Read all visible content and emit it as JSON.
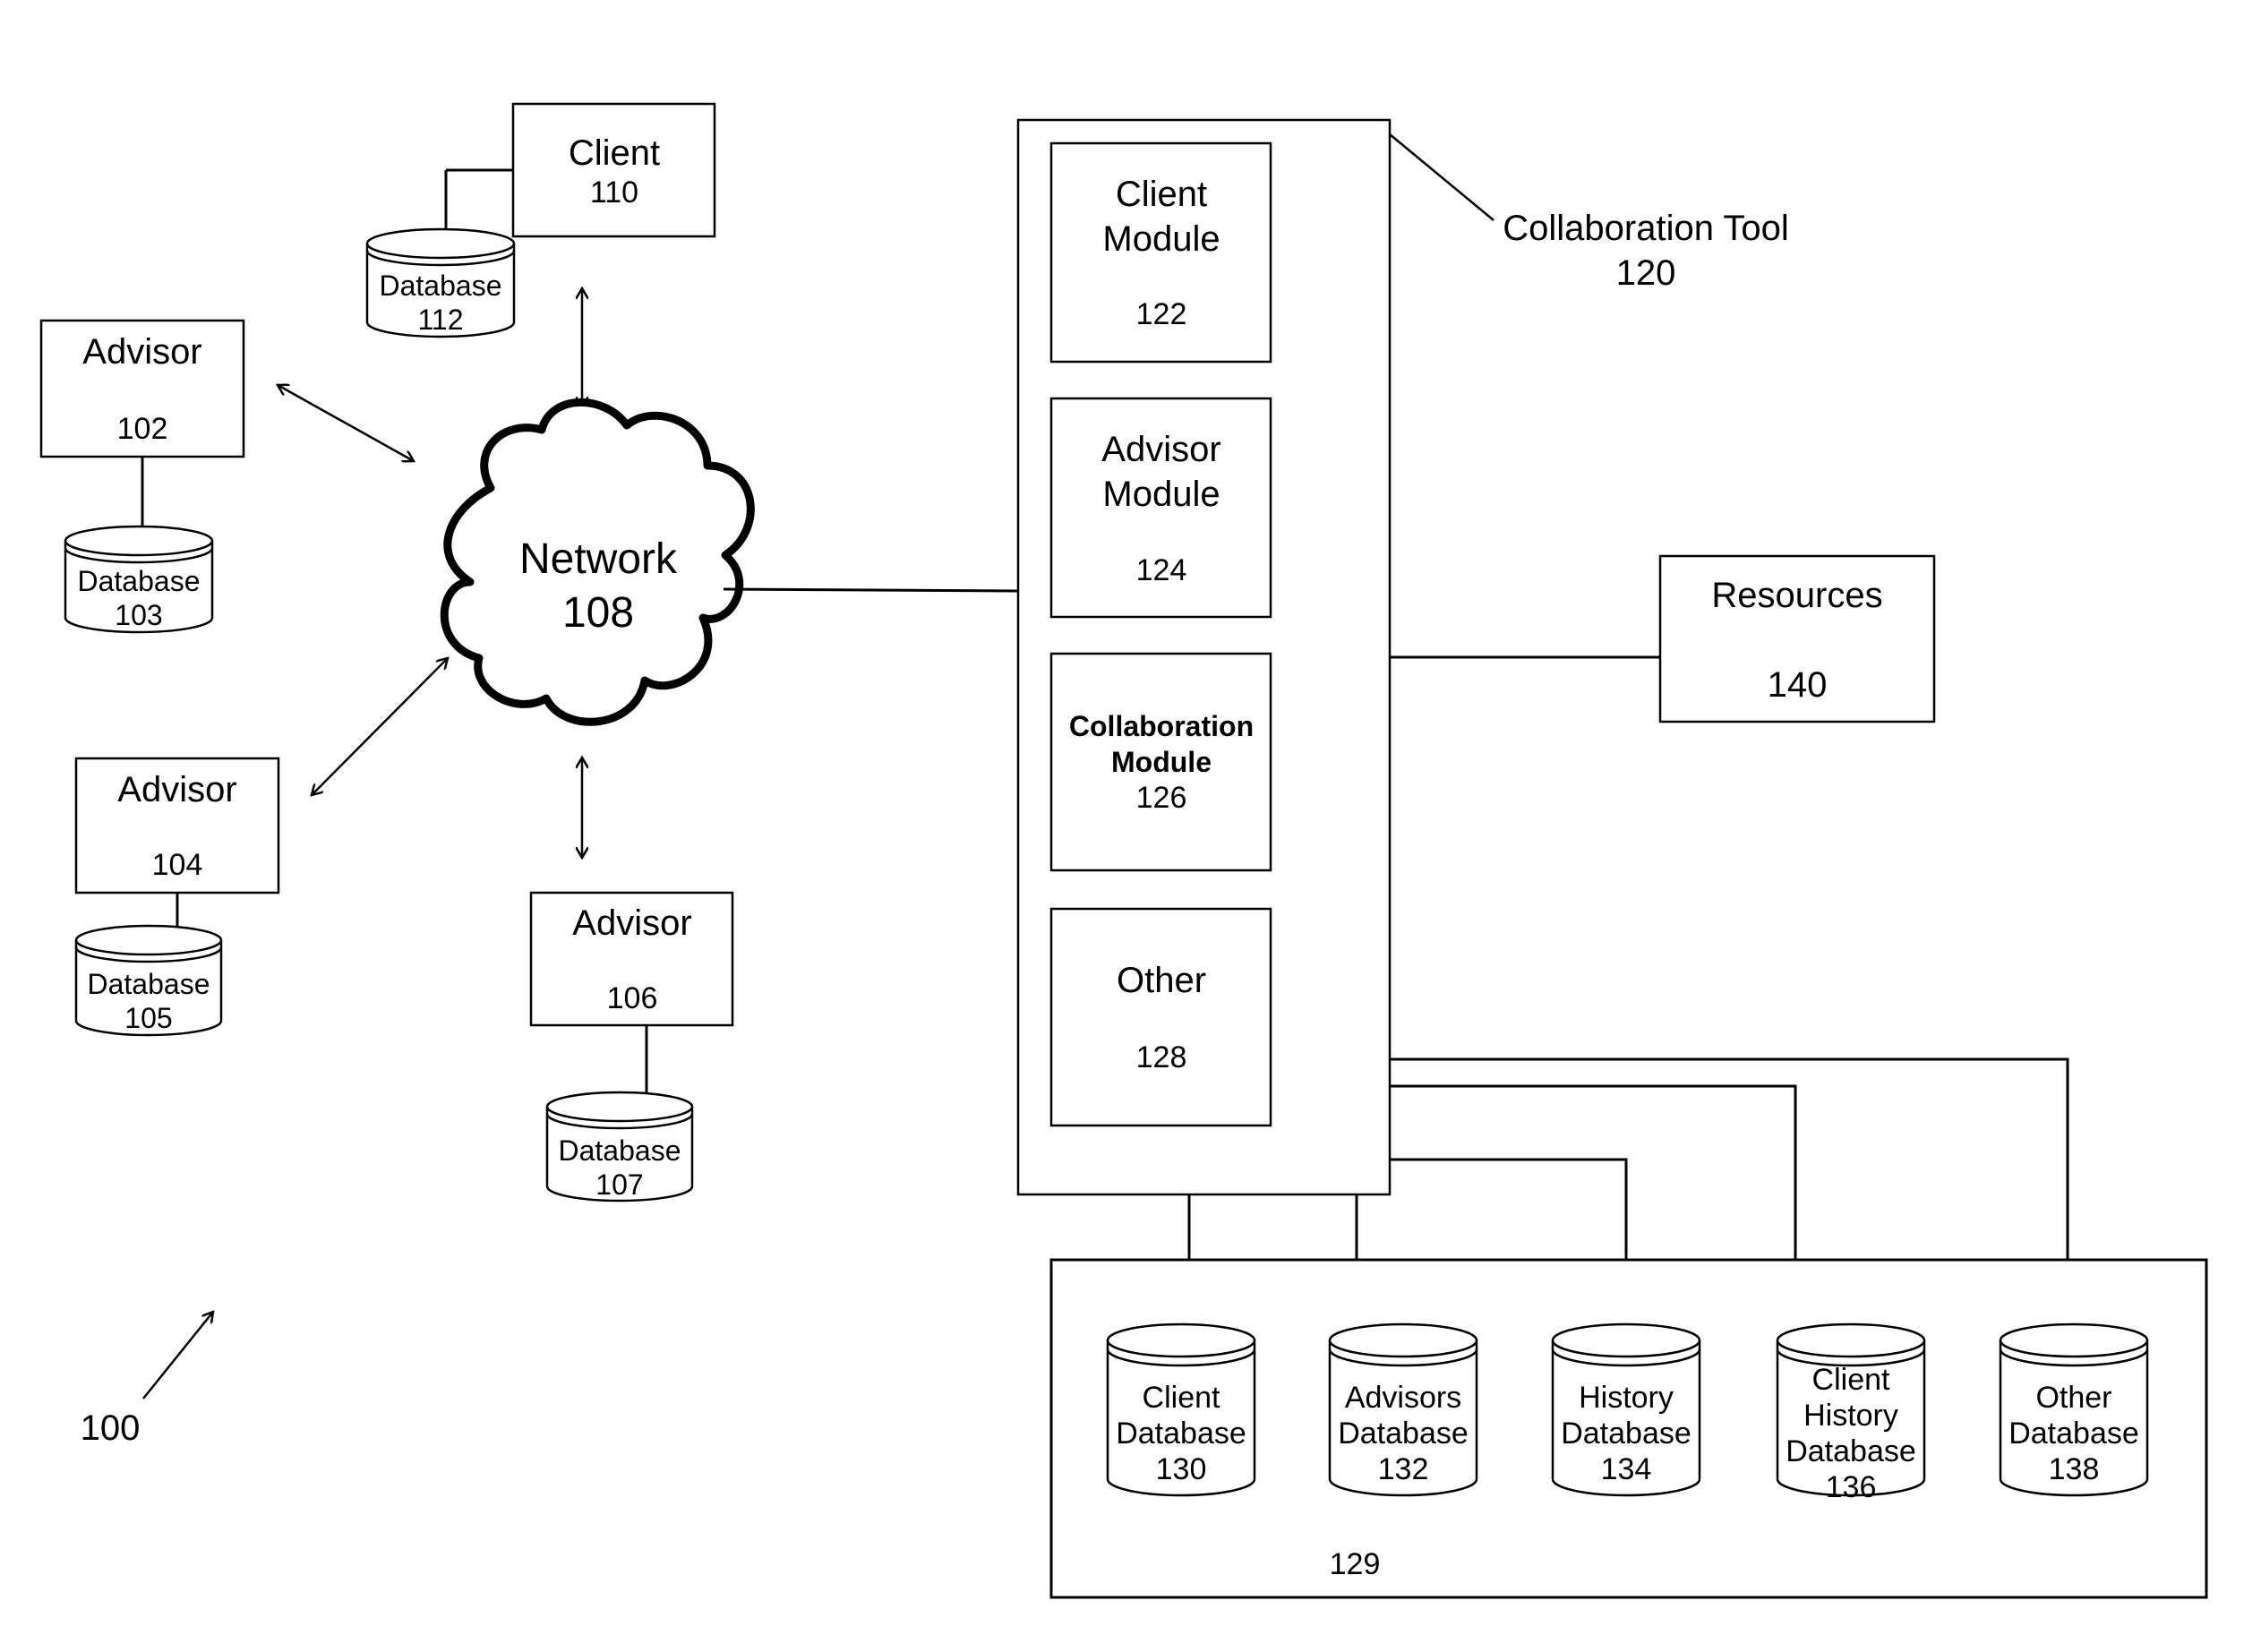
{
  "figure_label": "100",
  "network": {
    "name": "Network",
    "id": "108"
  },
  "client": {
    "name": "Client",
    "id": "110",
    "database": {
      "name": "Database",
      "id": "112"
    }
  },
  "advisors": [
    {
      "name": "Advisor",
      "id": "102",
      "database": {
        "name": "Database",
        "id": "103"
      }
    },
    {
      "name": "Advisor",
      "id": "104",
      "database": {
        "name": "Database",
        "id": "105"
      }
    },
    {
      "name": "Advisor",
      "id": "106",
      "database": {
        "name": "Database",
        "id": "107"
      }
    }
  ],
  "collaboration_tool": {
    "name": "Collaboration Tool",
    "id": "120",
    "modules": [
      {
        "line1": "Client",
        "line2": "Module",
        "id": "122"
      },
      {
        "line1": "Advisor",
        "line2": "Module",
        "id": "124"
      },
      {
        "line1": "Collaboration",
        "line2": "Module",
        "id": "126"
      },
      {
        "line1": "Other",
        "line2": "",
        "id": "128"
      }
    ]
  },
  "resources": {
    "name": "Resources",
    "id": "140"
  },
  "database_group": {
    "id": "129",
    "databases": [
      {
        "lines": [
          "Client",
          "Database",
          "130"
        ]
      },
      {
        "lines": [
          "Advisors",
          "Database",
          "132"
        ]
      },
      {
        "lines": [
          "History",
          "Database",
          "134"
        ]
      },
      {
        "lines": [
          "Client",
          "History",
          "Database",
          "136"
        ]
      },
      {
        "lines": [
          "Other",
          "Database",
          "138"
        ]
      }
    ]
  }
}
